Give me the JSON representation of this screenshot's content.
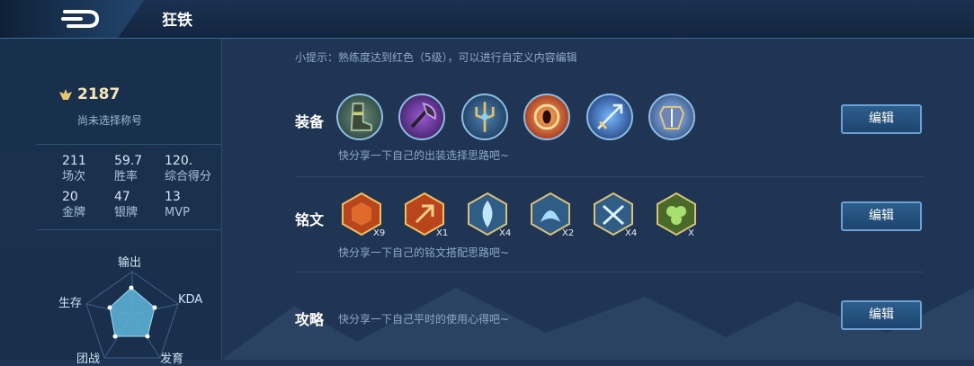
{
  "header": {
    "title": "狂铁"
  },
  "profile": {
    "score": "2187",
    "title_status": "尚未选择称号",
    "stats": [
      {
        "value": "211",
        "label": "场次"
      },
      {
        "value": "59.7",
        "label": "胜率"
      },
      {
        "value": "120.",
        "label": "综合得分"
      },
      {
        "value": "20",
        "label": "金牌"
      },
      {
        "value": "47",
        "label": "银牌"
      },
      {
        "value": "13",
        "label": "MVP"
      }
    ],
    "radar": {
      "labels": {
        "top": "输出",
        "left": "生存",
        "right": "KDA",
        "bottom_left": "团战",
        "bottom_right": "发育"
      }
    }
  },
  "main": {
    "hint": "小提示：熟练度达到红色（5级），可以进行自定义内容编辑",
    "equipment": {
      "label": "装备",
      "share": "快分享一下自己的出装选择思路吧~",
      "edit": "编辑",
      "items": [
        "boots-icon",
        "axe-icon",
        "trident-icon",
        "eye-orb-icon",
        "spear-icon",
        "armor-icon"
      ]
    },
    "runes": {
      "label": "铭文",
      "share": "快分享一下自己的铭文搭配思路吧~",
      "edit": "编辑",
      "items": [
        {
          "icon": "red-rune-icon",
          "count": "X9"
        },
        {
          "icon": "red-rune-icon",
          "count": "X1"
        },
        {
          "icon": "blue-rune-icon",
          "count": "X4"
        },
        {
          "icon": "blue-rune-icon",
          "count": "X2"
        },
        {
          "icon": "blue-rune-icon",
          "count": "X4"
        },
        {
          "icon": "green-rune-icon",
          "count": "X"
        }
      ]
    },
    "strategy": {
      "label": "攻略",
      "share": "快分享一下自己平时的使用心得吧~",
      "edit": "编辑"
    }
  }
}
